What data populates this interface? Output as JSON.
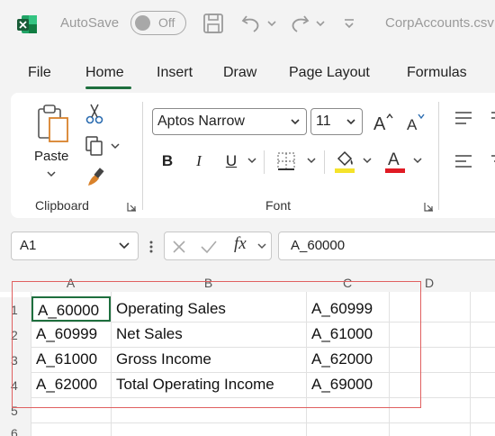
{
  "titlebar": {
    "autosave_label": "AutoSave",
    "autosave_state": "Off",
    "doc_title": "CorpAccounts.csv",
    "brand_color": "#1e6f3e"
  },
  "tabs": [
    "File",
    "Home",
    "Insert",
    "Draw",
    "Page Layout",
    "Formulas"
  ],
  "active_tab": "Home",
  "ribbon": {
    "clipboard": {
      "paste_label": "Paste",
      "group_label": "Clipboard"
    },
    "font": {
      "font_name": "Aptos Narrow",
      "font_size": "11",
      "group_label": "Font",
      "highlight_color": "#f5e32b",
      "font_color": "#e01b24"
    }
  },
  "formula_bar": {
    "name_box": "A1",
    "formula": "A_60000"
  },
  "grid": {
    "columns": [
      "A",
      "B",
      "C",
      "D"
    ],
    "rows": [
      "1",
      "2",
      "3",
      "4",
      "5",
      "6"
    ],
    "cells": [
      [
        "A_60000",
        "Operating Sales",
        "A_60999"
      ],
      [
        "A_60999",
        "Net Sales",
        "A_61000"
      ],
      [
        "A_61000",
        "Gross Income",
        "A_62000"
      ],
      [
        "A_62000",
        "Total Operating Income",
        "A_69000"
      ]
    ],
    "highlight_color": "#e06060"
  }
}
